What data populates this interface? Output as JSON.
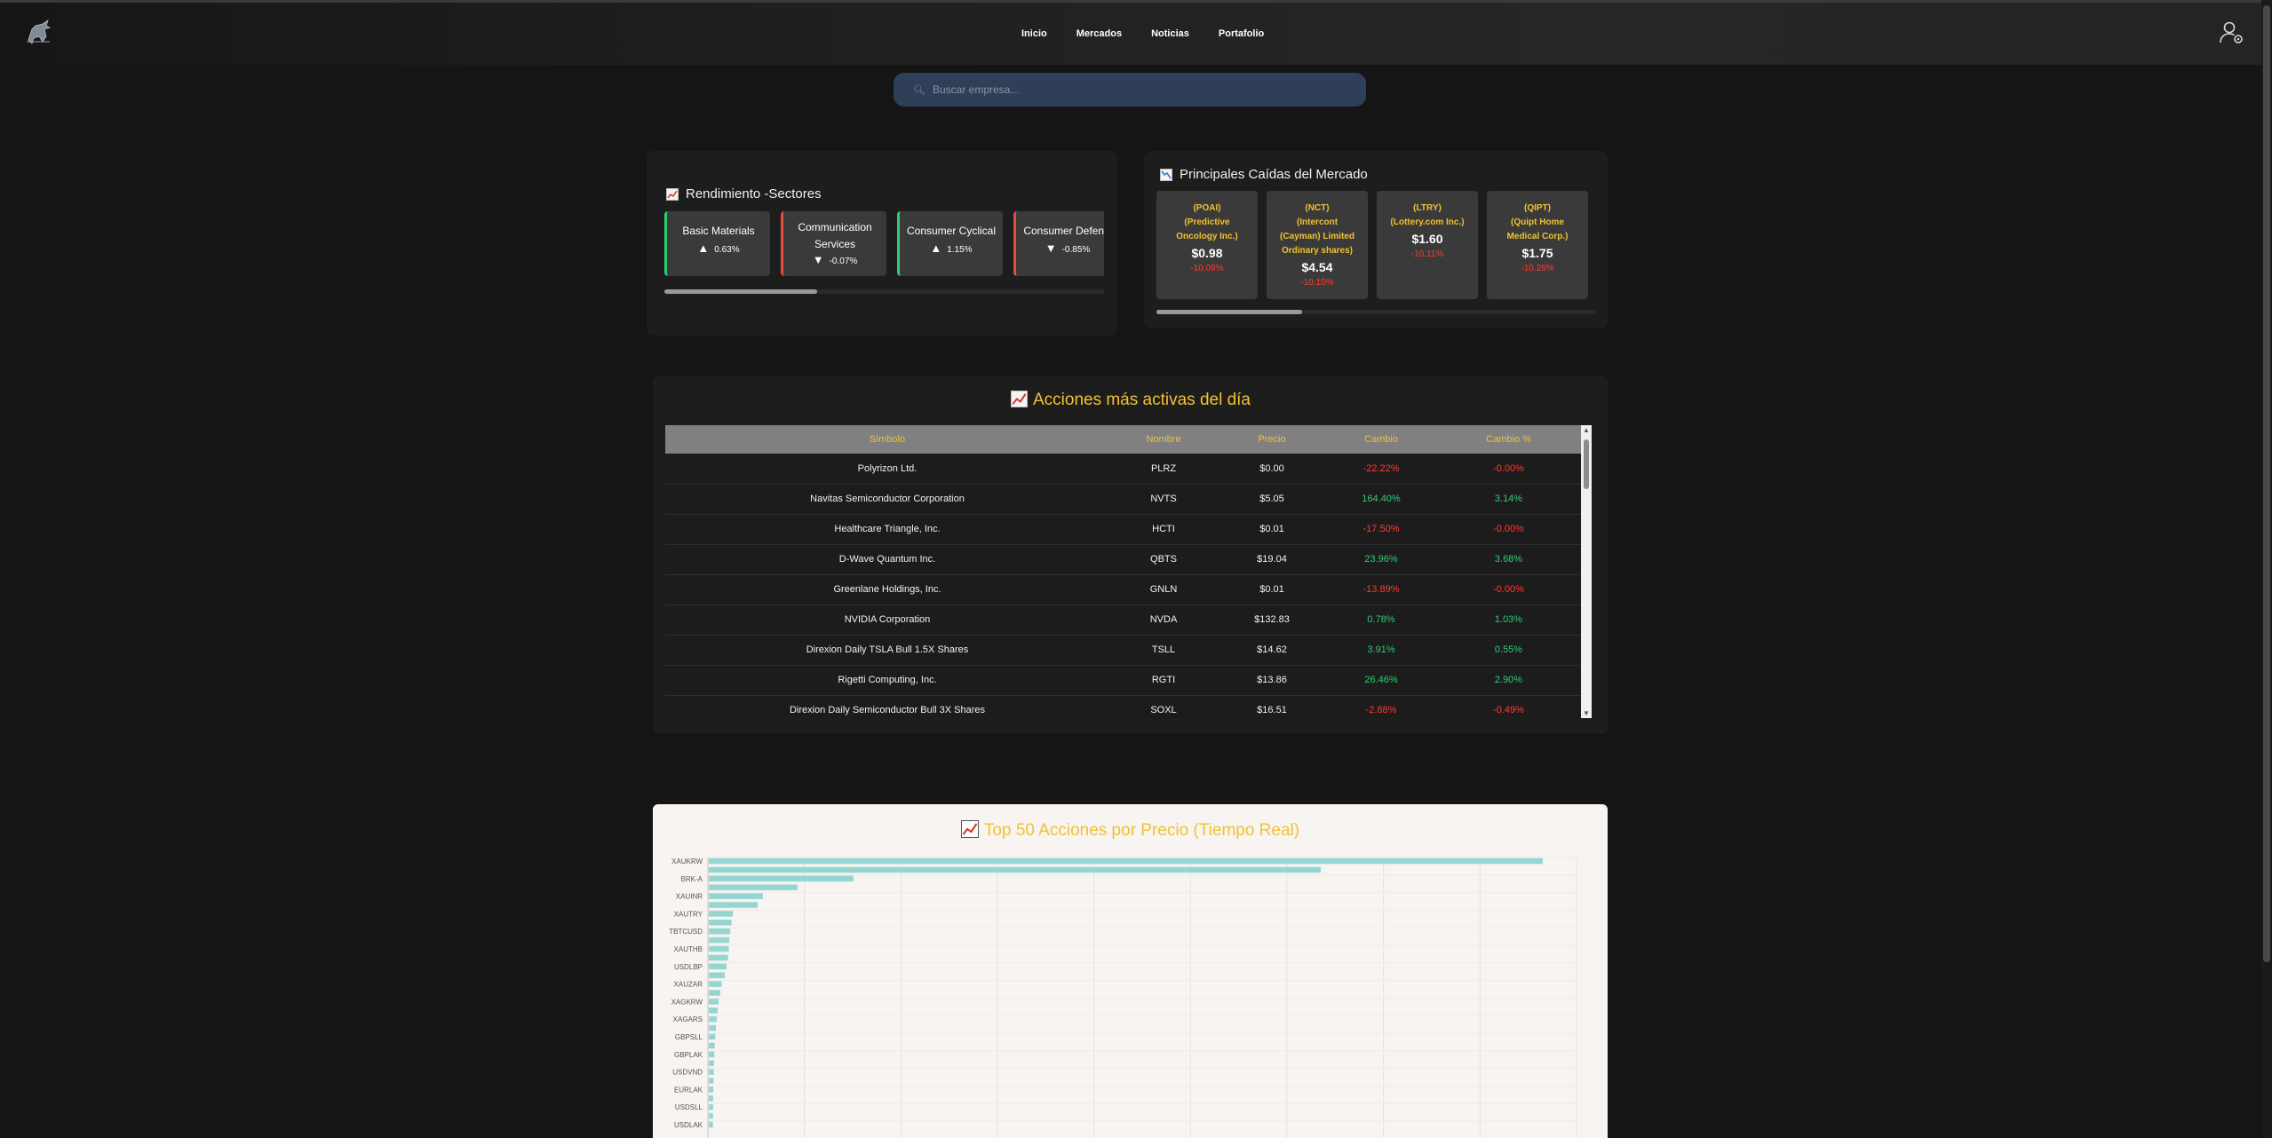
{
  "nav": {
    "links": [
      "Inicio",
      "Mercados",
      "Noticias",
      "Portafolio"
    ]
  },
  "search": {
    "placeholder": "Buscar empresa..."
  },
  "sectors": {
    "title": "Rendimiento -Sectores",
    "items": [
      {
        "name": "Basic Materials",
        "change": "0.63%",
        "direction": "up"
      },
      {
        "name": "Communication Services",
        "change": "-0.07%",
        "direction": "down"
      },
      {
        "name": "Consumer Cyclical",
        "change": "1.15%",
        "direction": "up"
      },
      {
        "name": "Consumer Defensi",
        "change": "-0.85%",
        "direction": "down"
      }
    ]
  },
  "drops": {
    "title": "Principales Caídas del Mercado",
    "items": [
      {
        "name_lines": [
          "(POAI)",
          "(Predictive",
          "Oncology Inc.)"
        ],
        "price": "$0.98",
        "change": "-10.09%"
      },
      {
        "name_lines": [
          "(NCT)",
          "(Intercont",
          "(Cayman) Limited",
          "Ordinary shares)"
        ],
        "price": "$4.54",
        "change": "-10.10%"
      },
      {
        "name_lines": [
          "(LTRY)",
          "(Lottery.com Inc.)"
        ],
        "price": "$1.60",
        "change": "-10.11%"
      },
      {
        "name_lines": [
          "(QIPT)",
          "(Quipt Home",
          "Medical Corp.)"
        ],
        "price": "$1.75",
        "change": "-10.26%"
      }
    ]
  },
  "active": {
    "title": "Acciones más activas del día",
    "columns": [
      "Símbolo",
      "Nombre",
      "Precio",
      "Cambio",
      "Cambio %"
    ],
    "rows": [
      {
        "symbol": "Polyrizon Ltd.",
        "name": "PLRZ",
        "price": "$0.00",
        "change": "-22.22%",
        "change_pct": "-0.00%",
        "trend": "neg"
      },
      {
        "symbol": "Navitas Semiconductor Corporation",
        "name": "NVTS",
        "price": "$5.05",
        "change": "164.40%",
        "change_pct": "3.14%",
        "trend": "pos"
      },
      {
        "symbol": "Healthcare Triangle, Inc.",
        "name": "HCTI",
        "price": "$0.01",
        "change": "-17.50%",
        "change_pct": "-0.00%",
        "trend": "neg"
      },
      {
        "symbol": "D-Wave Quantum Inc.",
        "name": "QBTS",
        "price": "$19.04",
        "change": "23.96%",
        "change_pct": "3.68%",
        "trend": "pos"
      },
      {
        "symbol": "Greenlane Holdings, Inc.",
        "name": "GNLN",
        "price": "$0.01",
        "change": "-13.89%",
        "change_pct": "-0.00%",
        "trend": "neg"
      },
      {
        "symbol": "NVIDIA Corporation",
        "name": "NVDA",
        "price": "$132.83",
        "change": "0.78%",
        "change_pct": "1.03%",
        "trend": "pos"
      },
      {
        "symbol": "Direxion Daily TSLA Bull 1.5X Shares",
        "name": "TSLL",
        "price": "$14.62",
        "change": "3.91%",
        "change_pct": "0.55%",
        "trend": "pos"
      },
      {
        "symbol": "Rigetti Computing, Inc.",
        "name": "RGTI",
        "price": "$13.86",
        "change": "26.46%",
        "change_pct": "2.90%",
        "trend": "pos"
      },
      {
        "symbol": "Direxion Daily Semiconductor Bull 3X Shares",
        "name": "SOXL",
        "price": "$16.51",
        "change": "-2.88%",
        "change_pct": "-0.49%",
        "trend": "neg"
      }
    ]
  },
  "top50": {
    "title": "Top 50 Acciones por Precio (Tiempo Real)"
  },
  "chart_data": {
    "type": "bar",
    "orientation": "horizontal",
    "title": "Top 50 Acciones por Precio (Tiempo Real)",
    "categories": [
      "XAUKRW",
      "",
      "BRK-A",
      "",
      "XAUINR",
      "",
      "XAUTRY",
      "",
      "TBTCUSD",
      "",
      "XAUTHB",
      "",
      "USDLBP",
      "",
      "XAUZAR",
      "",
      "XAGKRW",
      "",
      "XAGARS",
      "",
      "GBPSLL",
      "",
      "GBPLAK",
      "",
      "USDVND",
      "",
      "EURLAK",
      "",
      "USDSLL",
      "",
      "USDLAK"
    ],
    "values": [
      4320000,
      3170000,
      750000,
      460000,
      280000,
      253000,
      125000,
      118000,
      111000,
      106000,
      104000,
      100000,
      92000,
      83000,
      67000,
      59000,
      51000,
      46000,
      41000,
      37000,
      34000,
      31000,
      29000,
      27000,
      26000,
      25000,
      24000,
      23000,
      22500,
      22000,
      21500
    ],
    "xlim": [
      0,
      4500000
    ],
    "grid": true,
    "color": "#96d6d2"
  }
}
